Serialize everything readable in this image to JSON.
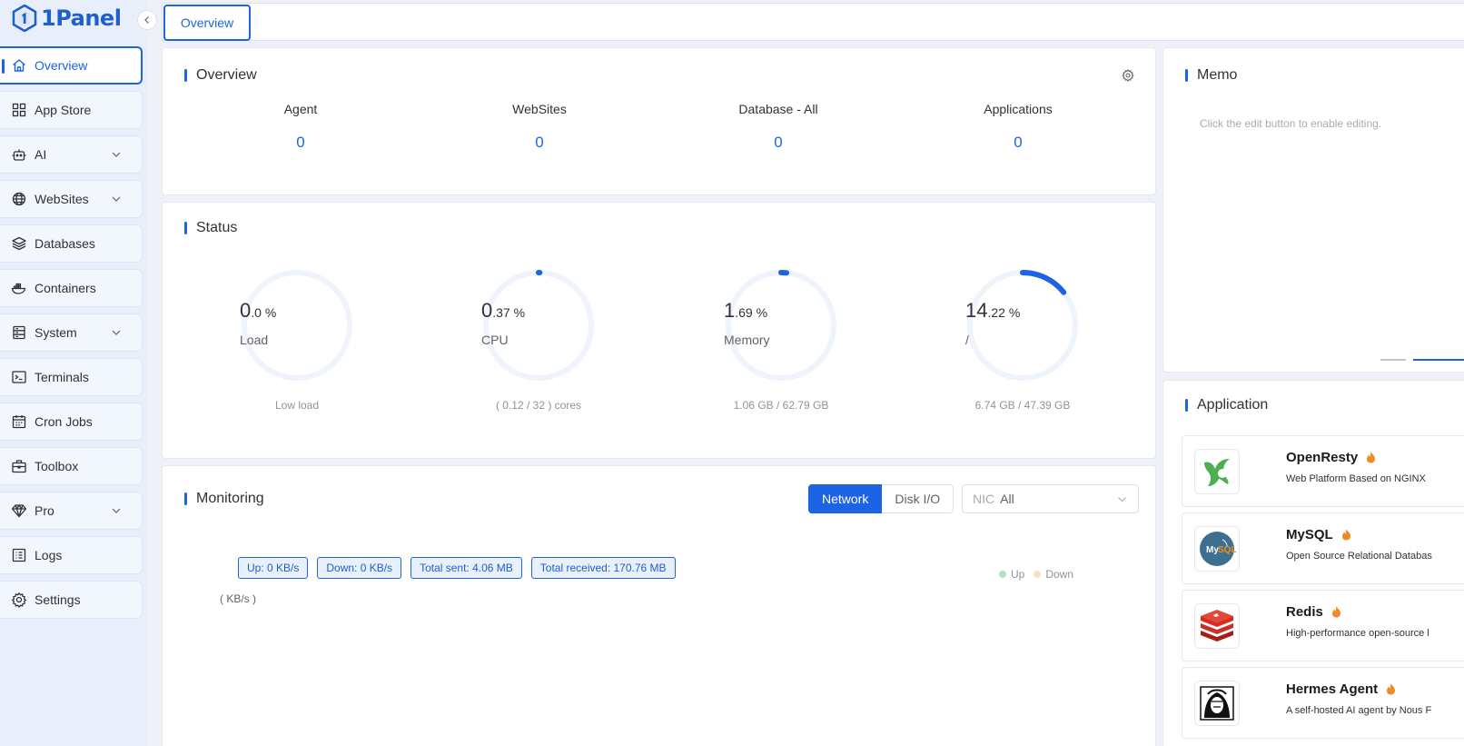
{
  "brand": {
    "name": "1Panel"
  },
  "sidebar": {
    "items": [
      {
        "label": "Overview",
        "icon": "home-icon",
        "active": true,
        "expandable": false
      },
      {
        "label": "App Store",
        "icon": "grid-icon",
        "active": false,
        "expandable": false
      },
      {
        "label": "AI",
        "icon": "robot-icon",
        "active": false,
        "expandable": true
      },
      {
        "label": "WebSites",
        "icon": "globe-icon",
        "active": false,
        "expandable": true
      },
      {
        "label": "Databases",
        "icon": "layers-icon",
        "active": false,
        "expandable": false
      },
      {
        "label": "Containers",
        "icon": "docker-icon",
        "active": false,
        "expandable": false
      },
      {
        "label": "System",
        "icon": "server-icon",
        "active": false,
        "expandable": true
      },
      {
        "label": "Terminals",
        "icon": "terminal-icon",
        "active": false,
        "expandable": false
      },
      {
        "label": "Cron Jobs",
        "icon": "calendar-icon",
        "active": false,
        "expandable": false
      },
      {
        "label": "Toolbox",
        "icon": "toolbox-icon",
        "active": false,
        "expandable": false
      },
      {
        "label": "Pro",
        "icon": "diamond-icon",
        "active": false,
        "expandable": true
      },
      {
        "label": "Logs",
        "icon": "list-icon",
        "active": false,
        "expandable": false
      },
      {
        "label": "Settings",
        "icon": "gear-icon",
        "active": false,
        "expandable": false
      }
    ]
  },
  "tabs": [
    {
      "label": "Overview",
      "active": true
    }
  ],
  "overview": {
    "title": "Overview",
    "stats": [
      {
        "label": "Agent",
        "value": "0"
      },
      {
        "label": "WebSites",
        "value": "0"
      },
      {
        "label": "Database - All",
        "value": "0"
      },
      {
        "label": "Applications",
        "value": "0"
      }
    ]
  },
  "status": {
    "title": "Status",
    "gauges": [
      {
        "int": "0",
        "dec": ".0 %",
        "label": "Load",
        "percent": 0.0,
        "sub": "Low load"
      },
      {
        "int": "0",
        "dec": ".37 %",
        "label": "CPU",
        "percent": 0.37,
        "sub": "( 0.12 / 32 ) cores"
      },
      {
        "int": "1",
        "dec": ".69 %",
        "label": "Memory",
        "percent": 1.69,
        "sub": "1.06 GB / 62.79 GB"
      },
      {
        "int": "14",
        "dec": ".22 %",
        "label": "/",
        "percent": 14.22,
        "sub": "6.74 GB / 47.39 GB"
      }
    ],
    "colors": {
      "track": "#eef3fc",
      "arc": "#1d63e6"
    }
  },
  "monitoring": {
    "title": "Monitoring",
    "modes": [
      "Network",
      "Disk I/O"
    ],
    "active_mode": "Network",
    "nic": {
      "prefix": "NIC",
      "value": "All"
    },
    "tags": [
      "Up: 0 KB/s",
      "Down: 0 KB/s",
      "Total sent: 4.06 MB",
      "Total received: 170.76 MB"
    ],
    "unit": "( KB/s )",
    "legend": [
      {
        "name": "Up",
        "color": "#b8dfc0"
      },
      {
        "name": "Down",
        "color": "#f8e2c0"
      }
    ]
  },
  "memo": {
    "title": "Memo",
    "hint": "Click the edit button to enable editing."
  },
  "application": {
    "title": "Application",
    "items": [
      {
        "name": "OpenResty",
        "desc": "Web Platform Based on NGINX",
        "icon": "openresty-logo-icon"
      },
      {
        "name": "MySQL",
        "desc": "Open Source Relational Databas",
        "icon": "mysql-logo-icon"
      },
      {
        "name": "Redis",
        "desc": "High-performance open-source l",
        "icon": "redis-logo-icon"
      },
      {
        "name": "Hermes Agent",
        "desc": "A self-hosted AI agent by Nous F",
        "icon": "hermes-logo-icon"
      }
    ]
  },
  "colors": {
    "accent": "#1d63e6",
    "hot": "#f08a24"
  }
}
